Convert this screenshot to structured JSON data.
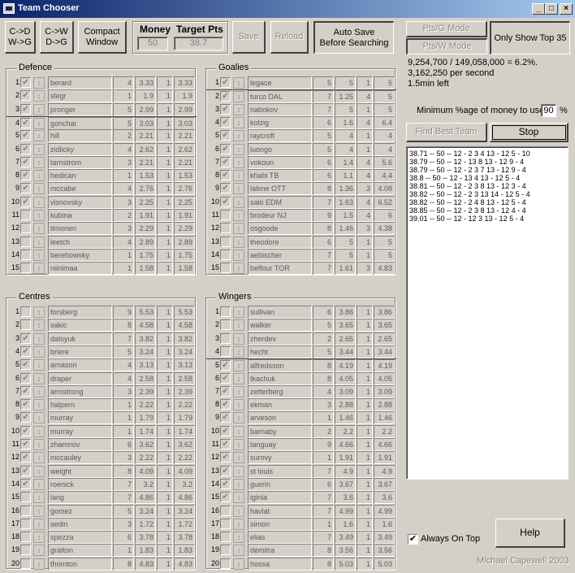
{
  "window": {
    "title": "Team Chooser",
    "min_glyph": "_",
    "max_glyph": "□",
    "close_glyph": "×"
  },
  "toolbar": {
    "cd_wg": "C->D\nW->G",
    "cw_dg": "C->W\nD->G",
    "compact": "Compact\nWindow",
    "money_label": "Money",
    "money_value": "50",
    "target_label": "Target Pts",
    "target_value": "38.7",
    "save": "Save",
    "reload": "Reload",
    "autosave": "Auto Save\nBefore Searching"
  },
  "modes": {
    "pts_g": "Pts/G Mode",
    "pts_w": "Pts/W Mode",
    "top35": "Only Show Top 35"
  },
  "stats": {
    "line1": "9,254,700 / 149,058,000 = 6.2%.",
    "line2": "3,162,250 per second",
    "line3": "1.5min left"
  },
  "min_money": {
    "label": "Minimum %age of money to use",
    "value": "90",
    "suffix": "%"
  },
  "actions": {
    "find": "Find Best Team",
    "stop": "Stop",
    "help": "Help"
  },
  "results": [
    "38.71 -- 50 -- 12 - 2 3 4 13 - 12 5 - 10",
    "38.79 -- 50 -- 12 - 13 8 13 - 12 9 - 4",
    "38.79 -- 50 -- 12 - 2 3 7 13 - 12 9 - 4",
    "38.8 -- 50 -- 12 - 13 4 13 - 12 5 - 4",
    "38.81 -- 50 -- 12 - 2 3 8 13 - 12 3 - 4",
    "38.82 -- 50 -- 12 - 2 3 13 14 - 12 5 - 4",
    "38.82 -- 50 -- 12 - 2 4 8 13 - 12 5 - 4",
    "38.85 -- 50 -- 12 - 2 3 8 13 - 12 4 - 4",
    "39.01 -- 50 -- 12 - 12 3 13 - 12 5 - 4"
  ],
  "always_on_top": {
    "label": "Always On Top",
    "checked": "✔"
  },
  "credit": "Michael Capewell 2003",
  "check_mark": "✔",
  "lock_glyph": "↕",
  "groups": [
    {
      "title": "Defence",
      "players": [
        [
          "1",
          "berard",
          "4",
          "3.33",
          "1",
          "3.33",
          true
        ],
        [
          "2",
          "slegr",
          "1",
          "1.9",
          "1",
          "1.9",
          true
        ],
        [
          "3",
          "pronger",
          "5",
          "2.99",
          "1",
          "2.99",
          true
        ],
        [
          "4",
          "gonchar",
          "5",
          "3.03",
          "1",
          "3.03",
          true
        ],
        [
          "5",
          "hill",
          "2",
          "2.21",
          "1",
          "2.21",
          true
        ],
        [
          "6",
          "zidlicky",
          "4",
          "2.62",
          "1",
          "2.62",
          true
        ],
        [
          "7",
          "tarnstrom",
          "3",
          "2.21",
          "1",
          "2.21",
          true
        ],
        [
          "8",
          "hedican",
          "1",
          "1.53",
          "1",
          "1.53",
          true
        ],
        [
          "9",
          "mccabe",
          "4",
          "2.76",
          "1",
          "2.76",
          true
        ],
        [
          "10",
          "visnovsky",
          "3",
          "2.25",
          "1",
          "2.25",
          true
        ],
        [
          "11",
          "kubina",
          "2",
          "1.91",
          "1",
          "1.91",
          false
        ],
        [
          "12",
          "timonen",
          "3",
          "2.29",
          "1",
          "2.29",
          false
        ],
        [
          "13",
          "leetch",
          "4",
          "2.89",
          "1",
          "2.89",
          false
        ],
        [
          "14",
          "berehowsky",
          "1",
          "1.75",
          "1",
          "1.75",
          false
        ],
        [
          "15",
          "niinimaa",
          "1",
          "1.58",
          "1",
          "1.58",
          false
        ]
      ]
    },
    {
      "title": "Goalies",
      "players": [
        [
          "1",
          "legace",
          "5",
          "5",
          "1",
          "5",
          true
        ],
        [
          "2",
          "turco DAL",
          "7",
          "1.25",
          "4",
          "5",
          true
        ],
        [
          "3",
          "nabokov",
          "7",
          "5",
          "1",
          "5",
          true
        ],
        [
          "4",
          "kolzig",
          "6",
          "1.6",
          "4",
          "6.4",
          true
        ],
        [
          "5",
          "raycroft",
          "5",
          "4",
          "1",
          "4",
          true
        ],
        [
          "6",
          "luongo",
          "5",
          "4",
          "1",
          "4",
          true
        ],
        [
          "7",
          "vokoun",
          "6",
          "1.4",
          "4",
          "5.6",
          true
        ],
        [
          "8",
          "khabi TB",
          "6",
          "1.1",
          "4",
          "4.4",
          true
        ],
        [
          "9",
          "lalime OTT",
          "8",
          "1.36",
          "3",
          "4.08",
          true
        ],
        [
          "10",
          "salo EDM",
          "7",
          "1.63",
          "4",
          "6.52",
          true
        ],
        [
          "11",
          "brodeur NJ",
          "9",
          "1.5",
          "4",
          "6",
          false
        ],
        [
          "12",
          "osgoode",
          "8",
          "1.46",
          "3",
          "4.38",
          false
        ],
        [
          "13",
          "theodore",
          "6",
          "5",
          "1",
          "5",
          false
        ],
        [
          "14",
          "aebischer",
          "7",
          "5",
          "1",
          "5",
          false
        ],
        [
          "15",
          "belfour TOR",
          "7",
          "1.61",
          "3",
          "4.83",
          false
        ]
      ]
    },
    {
      "title": "Centres",
      "players": [
        [
          "1",
          "forsberg",
          "9",
          "5.53",
          "1",
          "5.53",
          false
        ],
        [
          "2",
          "sakic",
          "8",
          "4.58",
          "1",
          "4.58",
          false
        ],
        [
          "3",
          "datsyuk",
          "7",
          "3.82",
          "1",
          "3.82",
          true
        ],
        [
          "4",
          "briere",
          "5",
          "3.24",
          "1",
          "3.24",
          true
        ],
        [
          "5",
          "arnason",
          "4",
          "3.13",
          "1",
          "3.13",
          true
        ],
        [
          "6",
          "draper",
          "4",
          "2.58",
          "1",
          "2.58",
          true
        ],
        [
          "7",
          "armstrong",
          "3",
          "2.39",
          "1",
          "2.39",
          true
        ],
        [
          "8",
          "halpern",
          "1",
          "2.22",
          "1",
          "2.22",
          true
        ],
        [
          "9",
          "murray",
          "1",
          "1.79",
          "1",
          "1.79",
          true
        ],
        [
          "10",
          "murray",
          "1",
          "1.74",
          "1",
          "1.74",
          true
        ],
        [
          "11",
          "zhamnov",
          "6",
          "3.62",
          "1",
          "3.62",
          true
        ],
        [
          "12",
          "mccauley",
          "3",
          "2.22",
          "1",
          "2.22",
          true
        ],
        [
          "13",
          "weight",
          "8",
          "4.09",
          "1",
          "4.09",
          true
        ],
        [
          "14",
          "roenick",
          "7",
          "3.2",
          "1",
          "3.2",
          true
        ],
        [
          "15",
          "lang",
          "7",
          "4.86",
          "1",
          "4.86",
          false
        ],
        [
          "16",
          "gomez",
          "5",
          "3.24",
          "1",
          "3.24",
          false
        ],
        [
          "17",
          "sedin",
          "3",
          "1.72",
          "1",
          "1.72",
          false
        ],
        [
          "18",
          "spezza",
          "6",
          "3.78",
          "1",
          "3.78",
          false
        ],
        [
          "19",
          "gratton",
          "1",
          "1.83",
          "1",
          "1.83",
          false
        ],
        [
          "20",
          "thornton",
          "8",
          "4.83",
          "1",
          "4.83",
          false
        ]
      ]
    },
    {
      "title": "Wingers",
      "players": [
        [
          "1",
          "sullivan",
          "6",
          "3.86",
          "1",
          "3.86",
          false
        ],
        [
          "2",
          "walker",
          "5",
          "3.65",
          "1",
          "3.65",
          false
        ],
        [
          "3",
          "zherdev",
          "2",
          "2.65",
          "1",
          "2.65",
          false
        ],
        [
          "4",
          "hecht",
          "5",
          "3.44",
          "1",
          "3.44",
          false
        ],
        [
          "5",
          "alfredsson",
          "8",
          "4.19",
          "1",
          "4.19",
          true
        ],
        [
          "6",
          "tkachuk",
          "8",
          "4.05",
          "1",
          "4.05",
          true
        ],
        [
          "7",
          "zetterberg",
          "4",
          "3.09",
          "1",
          "3.09",
          true
        ],
        [
          "8",
          "ekman",
          "3",
          "2.88",
          "1",
          "2.88",
          true
        ],
        [
          "9",
          "arveson",
          "1",
          "1.46",
          "1",
          "1.46",
          true
        ],
        [
          "10",
          "barnaby",
          "2",
          "2.2",
          "1",
          "2.2",
          true
        ],
        [
          "11",
          "tanguay",
          "9",
          "4.66",
          "1",
          "4.66",
          true
        ],
        [
          "12",
          "surovy",
          "1",
          "1.91",
          "1",
          "1.91",
          true
        ],
        [
          "13",
          "st louis",
          "7",
          "4.9",
          "1",
          "4.9",
          true
        ],
        [
          "14",
          "guerin",
          "6",
          "3.67",
          "1",
          "3.67",
          true
        ],
        [
          "15",
          "iginla",
          "7",
          "3.6",
          "1",
          "3.6",
          true
        ],
        [
          "16",
          "havlat",
          "7",
          "4.99",
          "1",
          "4.99",
          false
        ],
        [
          "17",
          "simon",
          "1",
          "1.6",
          "1",
          "1.6",
          false
        ],
        [
          "18",
          "elias",
          "7",
          "3.49",
          "1",
          "3.49",
          false
        ],
        [
          "19",
          "demitra",
          "8",
          "3.56",
          "1",
          "3.56",
          false
        ],
        [
          "20",
          "hossa",
          "8",
          "5.03",
          "1",
          "5.03",
          false
        ]
      ]
    }
  ]
}
